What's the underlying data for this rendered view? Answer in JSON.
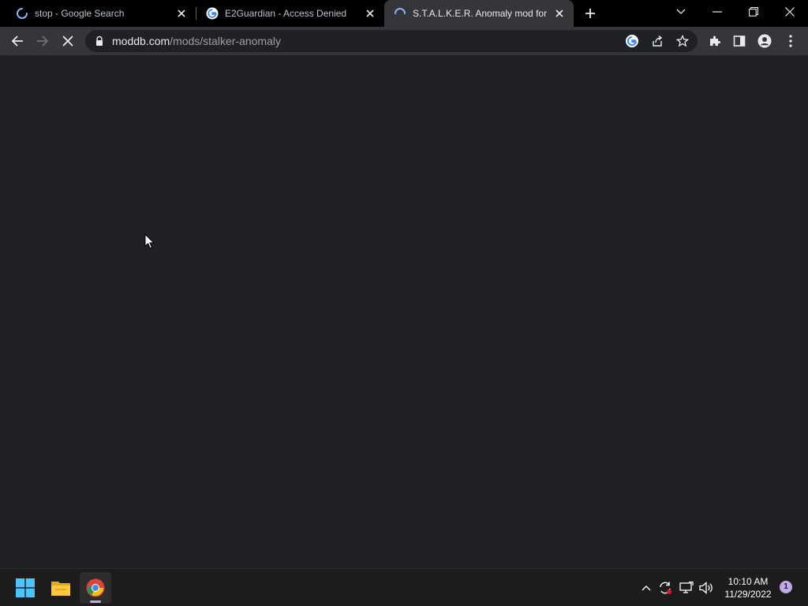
{
  "browser": {
    "tabs": [
      {
        "title": "stop - Google Search",
        "favicon": "loading-spinner-icon",
        "active": false
      },
      {
        "title": "E2Guardian - Access Denied",
        "favicon": "google-g-icon",
        "active": false
      },
      {
        "title": "S.T.A.L.K.E.R. Anomaly mod for S.T.A.L.K.E.R.",
        "favicon": "loading-spinner-icon",
        "active": true
      }
    ],
    "address_bar": {
      "host": "moddb.com",
      "path": "/mods/stalker-anomaly"
    },
    "accent_color": "#8ab4f8"
  },
  "taskbar": {
    "apps": [
      {
        "name": "windows-start-icon"
      },
      {
        "name": "file-explorer-icon"
      },
      {
        "name": "chrome-icon",
        "active": true
      }
    ],
    "clock": {
      "time": "10:10 AM",
      "date": "11/29/2022"
    },
    "notification_count": "1"
  }
}
